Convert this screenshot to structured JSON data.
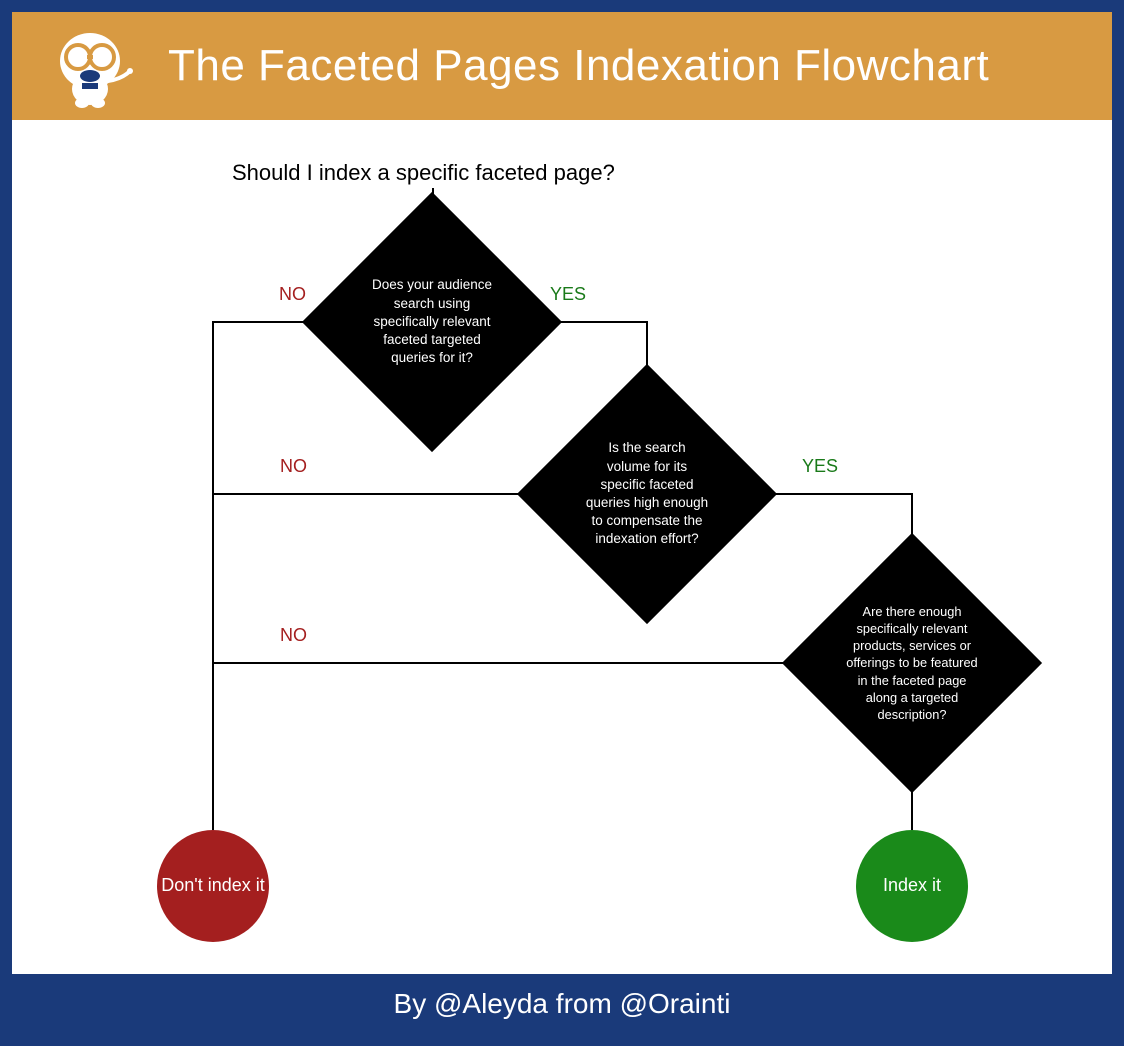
{
  "header": {
    "title": "The Faceted Pages Indexation Flowchart"
  },
  "footer": {
    "text": "By @Aleyda from @Orainti"
  },
  "flow": {
    "start_question": "Should I index a specific faceted page?",
    "diamond1": "Does your audience search using specifically relevant faceted targeted queries for it?",
    "diamond2": "Is the search volume for its specific faceted queries high enough to compensate the indexation effort?",
    "diamond3": "Are there enough specifically relevant products, services or offerings to be featured in the faceted page along a targeted description?",
    "label_no": "NO",
    "label_yes": "YES",
    "terminal_no": "Don't index it",
    "terminal_yes": "Index it"
  },
  "colors": {
    "frame": "#1a3a7a",
    "header": "#d89a42",
    "diamond": "#000000",
    "no": "#a41f1f",
    "yes": "#1a8a1a"
  }
}
